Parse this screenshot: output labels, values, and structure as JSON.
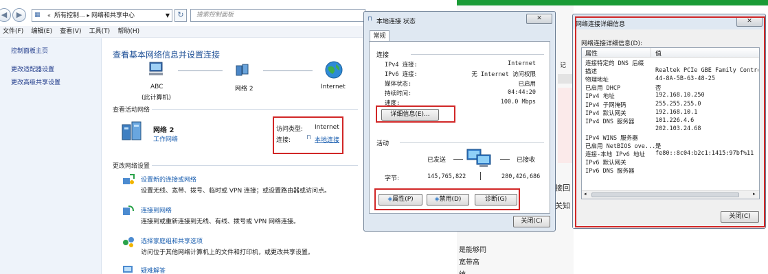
{
  "explorer": {
    "address_parts": [
      "所有控制...",
      "网络和共享中心"
    ],
    "search_placeholder": "搜索控制面板",
    "menu": [
      "文件(F)",
      "编辑(E)",
      "查看(V)",
      "工具(T)",
      "帮助(H)"
    ],
    "left_links": [
      "控制面板主页",
      "更改适配器设置",
      "更改高级共享设置"
    ],
    "main_title": "查看基本网络信息并设置连接",
    "map": {
      "pc": "ABC",
      "pc_sub": "(此计算机)",
      "network": "网络 2",
      "internet": "Internet"
    },
    "active_header": "查看活动网络",
    "network_name": "网络 2",
    "network_type": "工作网络",
    "access_label": "访问类型:",
    "access_value": "Internet",
    "conn_label": "连接:",
    "conn_value": "本地连接",
    "change_header": "更改网络设置",
    "tasks": [
      {
        "title": "设置新的连接或网络",
        "desc": "设置无线、宽带、拨号、临时或 VPN 连接；或设置路由器或访问点。"
      },
      {
        "title": "连接到网络",
        "desc": "连接到或重新连接到无线、有线、拨号或 VPN 网络连接。"
      },
      {
        "title": "选择家庭组和共享选项",
        "desc": "访问位于其他网络计算机上的文件和打印机，或更改共享设置。"
      },
      {
        "title": "疑难解答",
        "desc": ""
      }
    ]
  },
  "status_dialog": {
    "title": "本地连接 状态",
    "close": "✕",
    "tab": "常规",
    "connection_header": "连接",
    "rows": [
      {
        "label": "IPv4 连接:",
        "value": "Internet"
      },
      {
        "label": "IPv6 连接:",
        "value": "无 Internet 访问权限"
      },
      {
        "label": "媒体状态:",
        "value": "已启用"
      },
      {
        "label": "持续时间:",
        "value": "04:44:20"
      },
      {
        "label": "速度:",
        "value": "100.0 Mbps"
      }
    ],
    "details_button": "详细信息(E)...",
    "activity_header": "活动",
    "sent_label": "已发送",
    "recv_label": "已接收",
    "bytes_label": "字节:",
    "bytes_sent": "145,765,822",
    "bytes_recv": "280,426,686",
    "properties_button": "属性(P)",
    "disable_button": "禁用(D)",
    "diagnose_button": "诊断(G)",
    "close_button": "关闭(C)"
  },
  "details_dialog": {
    "title": "网络连接详细信息",
    "close": "✕",
    "subtitle": "网络连接详细信息(D):",
    "col_property": "属性",
    "col_value": "值",
    "rows": [
      {
        "k": "连接特定的 DNS 后缀",
        "v": ""
      },
      {
        "k": "描述",
        "v": "Realtek PCIe GBE Family Controlle"
      },
      {
        "k": "物理地址",
        "v": "44-8A-5B-63-48-25"
      },
      {
        "k": "已启用 DHCP",
        "v": "否"
      },
      {
        "k": "IPv4 地址",
        "v": "192.168.10.250"
      },
      {
        "k": "IPv4 子网掩码",
        "v": "255.255.255.0"
      },
      {
        "k": "IPv4 默认网关",
        "v": "192.168.10.1"
      },
      {
        "k": "IPv4 DNS 服务器",
        "v": "101.226.4.6"
      },
      {
        "k": "",
        "v": "202.103.24.68"
      },
      {
        "k": "IPv4 WINS 服务器",
        "v": ""
      },
      {
        "k": "已启用 NetBIOS ove...",
        "v": "是"
      },
      {
        "k": "连接-本地 IPv6 地址",
        "v": "fe80::8c04:b2c1:1415:97bf%11"
      },
      {
        "k": "IPv6 默认网关",
        "v": ""
      },
      {
        "k": "IPv6 DNS 服务器",
        "v": ""
      }
    ],
    "close_button": "关闭(C)"
  },
  "background": {
    "frag1": "接回",
    "frag2": "关知",
    "frag3": "是能够同",
    "frag4": "宽带高",
    "frag5": "统",
    "frag6": "记"
  }
}
